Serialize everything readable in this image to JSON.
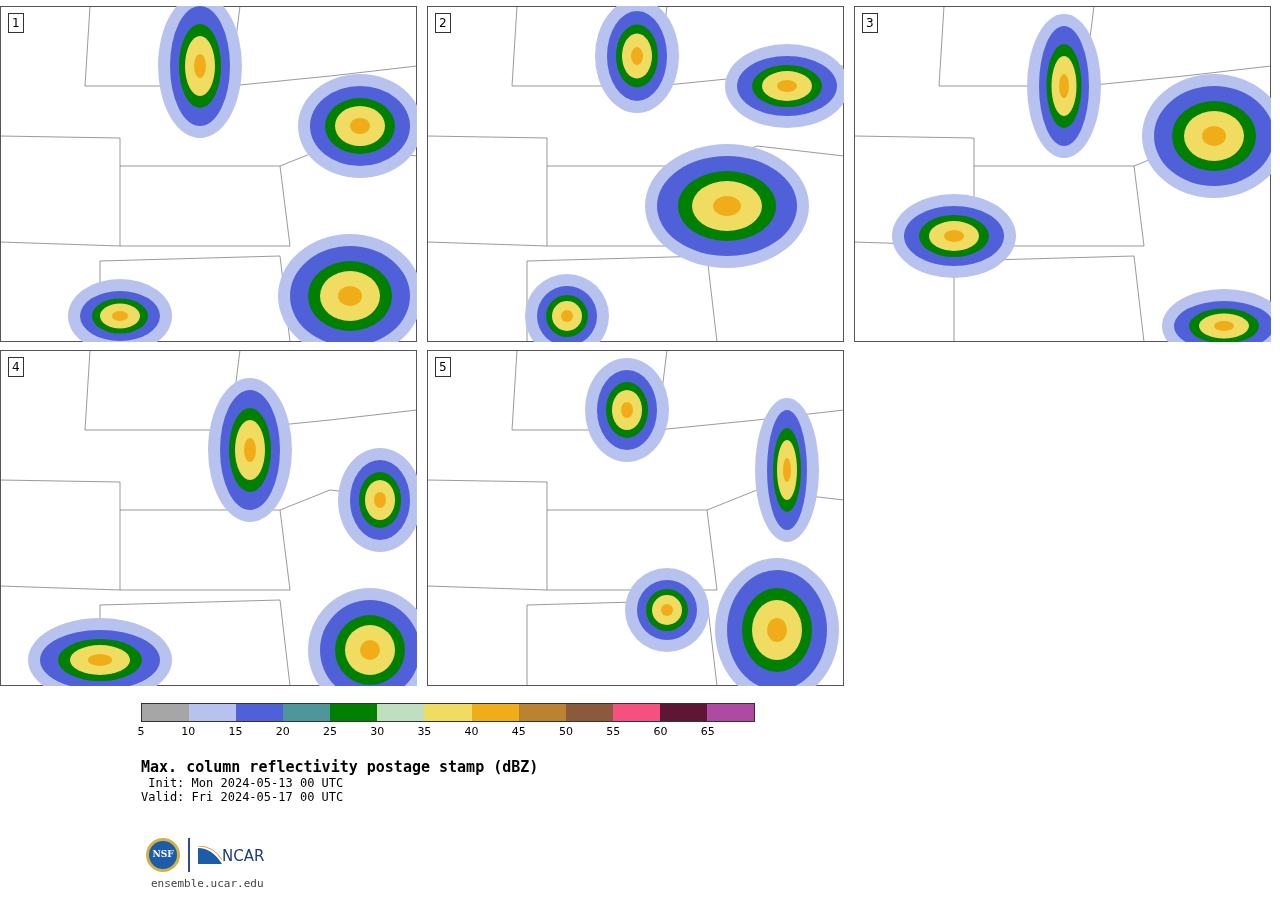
{
  "panels": [
    {
      "label": "1"
    },
    {
      "label": "2"
    },
    {
      "label": "3"
    },
    {
      "label": "4"
    },
    {
      "label": "5"
    }
  ],
  "colorbar": {
    "bins": [
      {
        "color": "#a6a6a6"
      },
      {
        "color": "#b7c3ee"
      },
      {
        "color": "#5060d8"
      },
      {
        "color": "#4f969b"
      },
      {
        "color": "#008000"
      },
      {
        "color": "#bfdfbf"
      },
      {
        "color": "#f0dc60"
      },
      {
        "color": "#f0ad19"
      },
      {
        "color": "#bb8330"
      },
      {
        "color": "#8b5a3c"
      },
      {
        "color": "#f55080"
      },
      {
        "color": "#5f1634"
      },
      {
        "color": "#ae4aa2"
      }
    ],
    "ticks": [
      "5",
      "10",
      "15",
      "20",
      "25",
      "30",
      "35",
      "40",
      "45",
      "50",
      "55",
      "60",
      "65"
    ]
  },
  "title": "Max. column reflectivity postage stamp (dBZ)",
  "init": " Init: Mon 2024-05-13 00 UTC",
  "valid": "Valid: Fri 2024-05-17 00 UTC",
  "logos": {
    "nsf": "NSF",
    "ncar": "NCAR"
  },
  "footer": "ensemble.ucar.edu"
}
